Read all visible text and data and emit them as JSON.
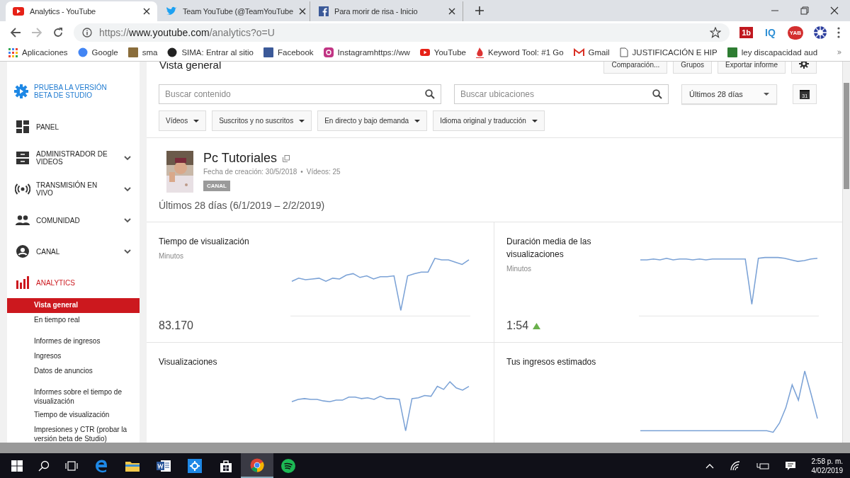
{
  "browser": {
    "tabs": [
      {
        "title": "Analytics - YouTube",
        "kind": "youtube",
        "selected": true
      },
      {
        "title": "Team YouTube (@TeamYouTube",
        "kind": "twitter",
        "selected": false
      },
      {
        "title": "Para morir de risa - Inicio",
        "kind": "facebook",
        "selected": false
      }
    ],
    "url_host": "https://www.youtube.com",
    "url_path": "/analytics?o=U",
    "extensions": [
      {
        "label": "1b",
        "kind": "square"
      },
      {
        "label": "IQ",
        "kind": "plain"
      },
      {
        "label": "YAB",
        "kind": "round"
      }
    ],
    "bookmarks": [
      {
        "label": "Aplicaciones",
        "kind": "apps"
      },
      {
        "label": "Google",
        "kind": "google"
      },
      {
        "label": "sma"
      },
      {
        "label": "SIMA: Entrar al sitio",
        "kind": "sima"
      },
      {
        "label": "Facebook",
        "kind": "facebook"
      },
      {
        "label": "Instagramhttps://ww",
        "kind": "instagram"
      },
      {
        "label": "YouTube",
        "kind": "youtube"
      },
      {
        "label": "Keyword Tool: #1 Go",
        "kind": "flame"
      },
      {
        "label": "Gmail",
        "kind": "gmail"
      },
      {
        "label": "JUSTIFICACIÓN E HIP",
        "kind": "page"
      },
      {
        "label": "ley discapacidad aud",
        "kind": "shield"
      }
    ]
  },
  "sidebar": {
    "beta_link": "PRUEBA LA VERSIÓN BETA DE STUDIO",
    "items": [
      {
        "label": "PANEL",
        "kind": "dashboard",
        "expandable": false,
        "selected": false
      },
      {
        "label": "ADMINISTRADOR DE VIDEOS",
        "kind": "videos",
        "expandable": true,
        "selected": false
      },
      {
        "label": "TRANSMISIÓN EN VIVO",
        "kind": "live",
        "expandable": true,
        "selected": false
      },
      {
        "label": "COMUNIDAD",
        "kind": "people",
        "expandable": true,
        "selected": false
      },
      {
        "label": "CANAL",
        "kind": "account",
        "expandable": true,
        "selected": false
      },
      {
        "label": "ANALYTICS",
        "kind": "bars",
        "expandable": false,
        "selected": true
      }
    ],
    "sections": [
      {
        "items": [
          {
            "label": "Vista general",
            "selected": true
          },
          {
            "label": "En tiempo real",
            "selected": false
          }
        ]
      },
      {
        "items": [
          {
            "label": "Informes de ingresos",
            "selected": false
          },
          {
            "label": "Ingresos",
            "selected": false
          },
          {
            "label": "Datos de anuncios",
            "selected": false
          }
        ]
      },
      {
        "items": [
          {
            "label": "Informes sobre el tiempo de visualización",
            "selected": false
          },
          {
            "label": "Tiempo de visualización",
            "selected": false
          },
          {
            "label": "Impresiones y CTR (probar la versión beta de Studio)",
            "selected": false
          }
        ]
      }
    ]
  },
  "header": {
    "title": "Vista general",
    "buttons": [
      "Comparación...",
      "Grupos",
      "Exportar informe"
    ]
  },
  "search": [
    {
      "placeholder": "Buscar contenido"
    },
    {
      "placeholder": "Buscar ubicaciones"
    }
  ],
  "date_range": {
    "value": "Últimos 28 días",
    "calendar_day": "31"
  },
  "filters": [
    "Vídeos",
    "Suscritos y no suscritos",
    "En directo y bajo demanda",
    "Idioma original y traducción"
  ],
  "channel": {
    "name": "Pc Tutoriales",
    "created": "Fecha de creación: 30/5/2018",
    "separator": "•",
    "videos": "Vídeos: 25",
    "badge": "CANAL"
  },
  "period": "Últimos 28 días (6/1/2019 – 2/2/2019)",
  "cards": [
    {
      "title": "Tiempo de visualización",
      "unit": "Minutos",
      "value": "83.170",
      "rising": false
    },
    {
      "title": "Duración media de las visualizaciones",
      "unit": "Minutos",
      "value": "1:54",
      "rising": true
    },
    {
      "title": "Visualizaciones"
    },
    {
      "title": "Tus ingresos estimados"
    }
  ],
  "taskbar": {
    "apps": [
      {
        "kind": "edge",
        "active": false
      },
      {
        "kind": "folder",
        "active": false
      },
      {
        "kind": "word",
        "active": false
      },
      {
        "kind": "gear",
        "active": false
      },
      {
        "kind": "store",
        "active": false
      },
      {
        "kind": "chrome",
        "active": true
      },
      {
        "kind": "spotify",
        "active": false
      }
    ],
    "time": "2:58 p. m.",
    "date": "4/02/2019"
  }
}
